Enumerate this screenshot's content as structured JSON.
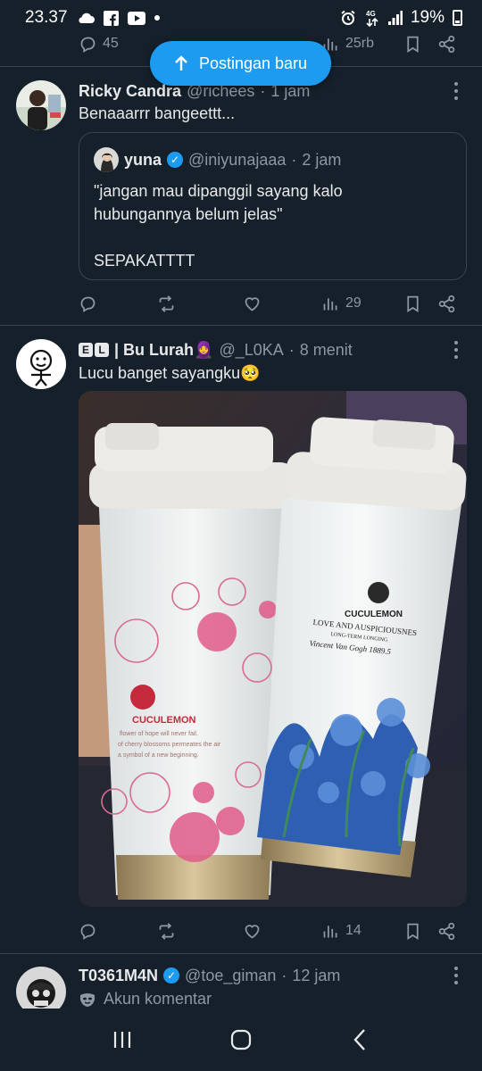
{
  "status_bar": {
    "time": "23.37",
    "battery": "19%"
  },
  "prev_tweet_actions": {
    "replies": "45",
    "views": "25rb"
  },
  "new_posts_button": {
    "label": "Postingan baru"
  },
  "tweet1": {
    "name": "Ricky Candra",
    "handle": "@richees",
    "separator": "·",
    "time": "1 jam",
    "text": "Benaaarrr bangeettt...",
    "quote": {
      "name": "yuna",
      "handle": "@iniyunajaaa",
      "separator": "·",
      "time": "2 jam",
      "line1": "\"jangan mau dipanggil sayang kalo",
      "line2": "hubungannya belum jelas\"",
      "line3": "SEPAKATTTT"
    },
    "views": "29"
  },
  "tweet2": {
    "badge_e": "E",
    "badge_l": "L",
    "name": "| Bu Lurah🧕",
    "handle": "@_L0KA",
    "separator": "·",
    "time": "8 menit",
    "text": "Lucu banget sayangku🥺",
    "media": {
      "left_brand": "CUCULEMON",
      "left_text_1": "flower of hope will never fail.",
      "left_text_2": "of cherry blossoms permeates the air",
      "left_text_3": "a symbol of a new beginning.",
      "right_brand": "CUCULEMON",
      "right_text_1": "LOVE AND AUSPICIOUSNES",
      "right_text_2": "LONG-TERM LONGING",
      "right_text_3": "Vincent Van Gogh 1889.5"
    },
    "views": "14"
  },
  "tweet3": {
    "name": "T0361M4N",
    "handle": "@toe_giman",
    "separator": "·",
    "time": "12 jam",
    "label": "Akun komentar"
  },
  "colors": {
    "background": "#15202b",
    "accent": "#1d9bf0",
    "muted": "#8b98a5",
    "border": "#38444d"
  }
}
